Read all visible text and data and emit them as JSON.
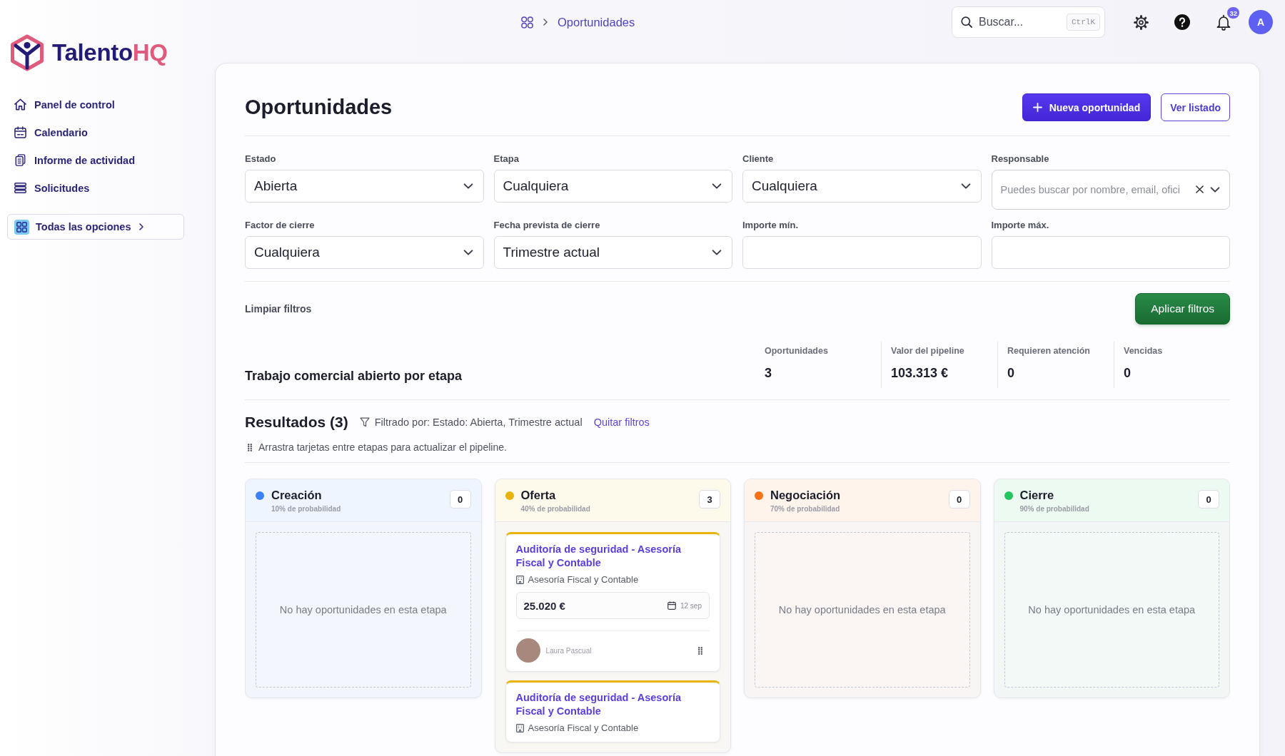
{
  "sidebar": {
    "logo": {
      "name": "Talento",
      "accent": "HQ"
    },
    "items": [
      {
        "label": "Panel de control",
        "selected": false
      },
      {
        "label": "Calendario",
        "selected": false
      },
      {
        "label": "Informe de actividad",
        "selected": false
      },
      {
        "label": "Solicitudes",
        "selected": false
      }
    ],
    "all_options": "Todas las opciones"
  },
  "topbar": {
    "breadcrumb": "Oportunidades",
    "search": {
      "placeholder": "Buscar...",
      "shortcut": "CtrlK"
    },
    "notifications": "32",
    "avatar": "A"
  },
  "header": {
    "title": "Oportunidades",
    "actions": [
      {
        "label": "Nueva oportunidad",
        "kind": "primary"
      },
      {
        "label": "Ver listado",
        "kind": "secondary"
      }
    ]
  },
  "filters": [
    {
      "label": "Estado",
      "kind": "select",
      "value": "Abierta"
    },
    {
      "label": "Etapa",
      "kind": "select",
      "value": "Cualquiera"
    },
    {
      "label": "Cliente",
      "kind": "select",
      "value": "Cualquiera"
    },
    {
      "label": "Responsable",
      "kind": "combobox",
      "placeholder": "Puedes buscar por nombre, email, ofici"
    },
    {
      "label": "Factor de cierre",
      "kind": "select",
      "value": "Cualquiera"
    },
    {
      "label": "Fecha prevista de cierre",
      "kind": "select",
      "value": "Trimestre actual"
    },
    {
      "label": "Importe mín.",
      "kind": "text"
    },
    {
      "label": "Importe máx.",
      "kind": "text"
    }
  ],
  "filter_actions": {
    "clear": "Limpiar filtros",
    "apply": "Aplicar filtros"
  },
  "summary": {
    "title": "Trabajo comercial abierto por etapa",
    "stats": [
      {
        "label": "Oportunidades",
        "value": "3"
      },
      {
        "label": "Valor del pipeline",
        "value": "103.313 €"
      },
      {
        "label": "Requieren atención",
        "value": "0"
      },
      {
        "label": "Vencidas",
        "value": "0"
      }
    ]
  },
  "results": {
    "title": "Resultados (3)",
    "filter_text": "Filtrado por: Estado: Abierta, Trimestre actual",
    "clear_link": "Quitar filtros",
    "hint": "Arrastra tarjetas entre etapas para actualizar el pipeline."
  },
  "stages": [
    {
      "name": "Creación",
      "probability": "10% de probabilidad",
      "count": "0",
      "color": "#3b82f6",
      "empty_text": "No hay oportunidades en esta etapa"
    },
    {
      "name": "Oferta",
      "probability": "40% de probabilidad",
      "count": "3",
      "color": "#eab308",
      "cards": [
        {
          "title": "Auditoría de seguridad - Asesoría Fiscal y Contable",
          "client": "Asesoría Fiscal y Contable",
          "amount": "25.020 €",
          "date": "12 sep",
          "owner": "Laura Pascual"
        },
        {
          "title": "Auditoría de seguridad - Asesoría Fiscal y Contable",
          "client": "Asesoría Fiscal y Contable"
        }
      ]
    },
    {
      "name": "Negociación",
      "probability": "70% de probabilidad",
      "count": "0",
      "color": "#f97316",
      "empty_text": "No hay oportunidades en esta etapa"
    },
    {
      "name": "Cierre",
      "probability": "90% de probabilidad",
      "count": "0",
      "color": "#22c55e",
      "empty_text": "No hay oportunidades en esta etapa"
    }
  ]
}
